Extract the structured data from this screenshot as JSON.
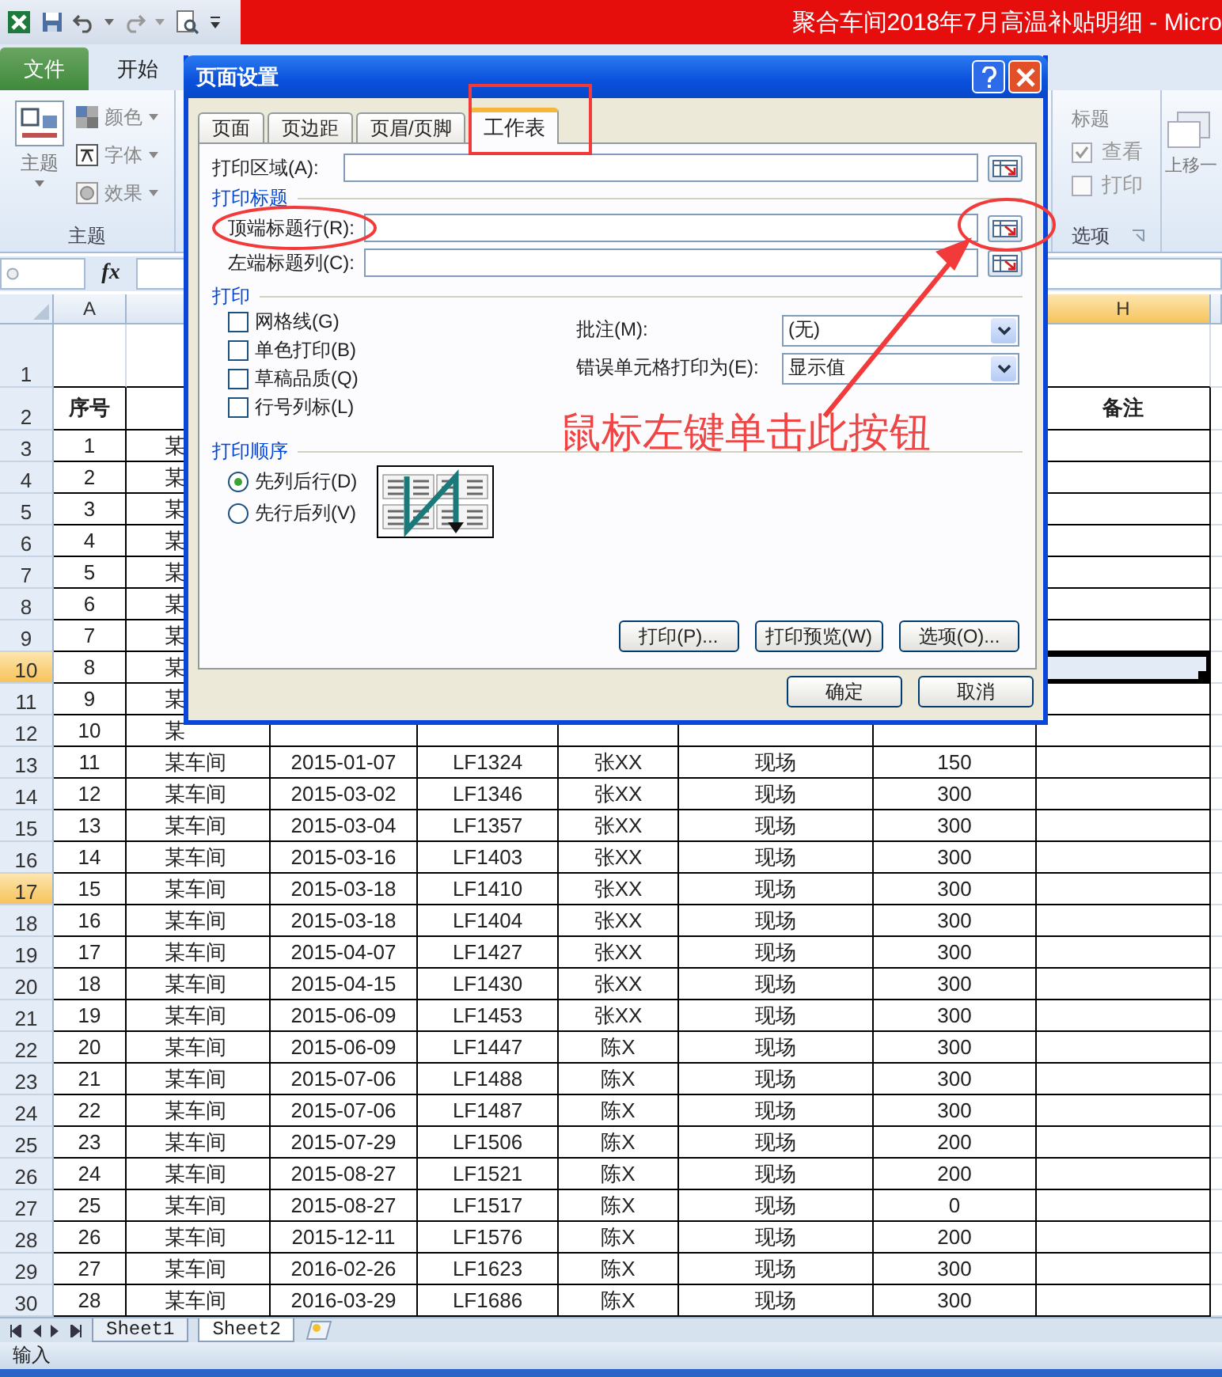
{
  "title_bar": {
    "title": "聚合车间2018年7月高温补贴明细 - Micro"
  },
  "ribbon_tabs": [
    {
      "label": "文件",
      "kind": "file"
    },
    {
      "label": "开始",
      "kind": "tab"
    }
  ],
  "ribbon": {
    "theme_group": {
      "big_button": "主题",
      "small_buttons": [
        "颜色",
        "字体",
        "效果"
      ],
      "label": "主题"
    },
    "sheet_options_group": {
      "heading": "标题",
      "checkboxes": [
        {
          "label": "查看",
          "checked": true
        },
        {
          "label": "打印",
          "checked": false
        }
      ],
      "label": "选项"
    },
    "arrange_button": "上移一"
  },
  "formula_bar": {
    "function_label": "fx"
  },
  "column_headers": [
    {
      "label": "A",
      "selected": false
    },
    {
      "label": "H",
      "selected": true
    }
  ],
  "rows": [
    {
      "number": "1",
      "selected": false,
      "note_cell_active": false
    },
    {
      "number": "2",
      "selected": false,
      "note_cell_active": false,
      "cells": [
        "序号",
        null,
        null,
        null,
        null,
        null,
        null,
        "备注"
      ]
    },
    {
      "number": "3",
      "selected": false,
      "note_cell_active": false,
      "cells": [
        "1",
        "某"
      ]
    },
    {
      "number": "4",
      "selected": false,
      "note_cell_active": false,
      "cells": [
        "2",
        "某"
      ]
    },
    {
      "number": "5",
      "selected": false,
      "note_cell_active": false,
      "cells": [
        "3",
        "某"
      ]
    },
    {
      "number": "6",
      "selected": false,
      "note_cell_active": false,
      "cells": [
        "4",
        "某"
      ]
    },
    {
      "number": "7",
      "selected": false,
      "note_cell_active": false,
      "cells": [
        "5",
        "某"
      ]
    },
    {
      "number": "8",
      "selected": false,
      "note_cell_active": false,
      "cells": [
        "6",
        "某"
      ]
    },
    {
      "number": "9",
      "selected": false,
      "note_cell_active": false,
      "cells": [
        "7",
        "某"
      ]
    },
    {
      "number": "10",
      "selected": true,
      "note_cell_active": true,
      "cells": [
        "8",
        "某"
      ]
    },
    {
      "number": "11",
      "selected": false,
      "note_cell_active": false,
      "cells": [
        "9",
        "某"
      ]
    },
    {
      "number": "12",
      "selected": false,
      "note_cell_active": false,
      "cells": [
        "10",
        "某"
      ]
    },
    {
      "number": "13",
      "selected": false,
      "note_cell_active": false,
      "cells": [
        "11",
        "某车间",
        "2015-01-07",
        "LF1324",
        "张XX",
        "现场",
        "150"
      ]
    },
    {
      "number": "14",
      "selected": false,
      "note_cell_active": false,
      "cells": [
        "12",
        "某车间",
        "2015-03-02",
        "LF1346",
        "张XX",
        "现场",
        "300"
      ]
    },
    {
      "number": "15",
      "selected": false,
      "note_cell_active": false,
      "cells": [
        "13",
        "某车间",
        "2015-03-04",
        "LF1357",
        "张XX",
        "现场",
        "300"
      ]
    },
    {
      "number": "16",
      "selected": false,
      "note_cell_active": false,
      "cells": [
        "14",
        "某车间",
        "2015-03-16",
        "LF1403",
        "张XX",
        "现场",
        "300"
      ]
    },
    {
      "number": "17",
      "selected": true,
      "note_cell_active": false,
      "cells": [
        "15",
        "某车间",
        "2015-03-18",
        "LF1410",
        "张XX",
        "现场",
        "300"
      ]
    },
    {
      "number": "18",
      "selected": false,
      "note_cell_active": false,
      "cells": [
        "16",
        "某车间",
        "2015-03-18",
        "LF1404",
        "张XX",
        "现场",
        "300"
      ]
    },
    {
      "number": "19",
      "selected": false,
      "note_cell_active": false,
      "cells": [
        "17",
        "某车间",
        "2015-04-07",
        "LF1427",
        "张XX",
        "现场",
        "300"
      ]
    },
    {
      "number": "20",
      "selected": false,
      "note_cell_active": false,
      "cells": [
        "18",
        "某车间",
        "2015-04-15",
        "LF1430",
        "张XX",
        "现场",
        "300"
      ]
    },
    {
      "number": "21",
      "selected": false,
      "note_cell_active": false,
      "cells": [
        "19",
        "某车间",
        "2015-06-09",
        "LF1453",
        "张XX",
        "现场",
        "300"
      ]
    },
    {
      "number": "22",
      "selected": false,
      "note_cell_active": false,
      "cells": [
        "20",
        "某车间",
        "2015-06-09",
        "LF1447",
        "陈X",
        "现场",
        "300"
      ]
    },
    {
      "number": "23",
      "selected": false,
      "note_cell_active": false,
      "cells": [
        "21",
        "某车间",
        "2015-07-06",
        "LF1488",
        "陈X",
        "现场",
        "300"
      ]
    },
    {
      "number": "24",
      "selected": false,
      "note_cell_active": false,
      "cells": [
        "22",
        "某车间",
        "2015-07-06",
        "LF1487",
        "陈X",
        "现场",
        "300"
      ]
    },
    {
      "number": "25",
      "selected": false,
      "note_cell_active": false,
      "cells": [
        "23",
        "某车间",
        "2015-07-29",
        "LF1506",
        "陈X",
        "现场",
        "200"
      ]
    },
    {
      "number": "26",
      "selected": false,
      "note_cell_active": false,
      "cells": [
        "24",
        "某车间",
        "2015-08-27",
        "LF1521",
        "陈X",
        "现场",
        "200"
      ]
    },
    {
      "number": "27",
      "selected": false,
      "note_cell_active": false,
      "cells": [
        "25",
        "某车间",
        "2015-08-27",
        "LF1517",
        "陈X",
        "现场",
        "0"
      ]
    },
    {
      "number": "28",
      "selected": false,
      "note_cell_active": false,
      "cells": [
        "26",
        "某车间",
        "2015-12-11",
        "LF1576",
        "陈X",
        "现场",
        "200"
      ]
    },
    {
      "number": "29",
      "selected": false,
      "note_cell_active": false,
      "cells": [
        "27",
        "某车间",
        "2016-02-26",
        "LF1623",
        "陈X",
        "现场",
        "300"
      ]
    },
    {
      "number": "30",
      "selected": false,
      "note_cell_active": false,
      "cells": [
        "28",
        "某车间",
        "2016-03-29",
        "LF1686",
        "陈X",
        "现场",
        "300"
      ]
    }
  ],
  "sheet_tabs": [
    {
      "label": "Sheet1",
      "selected": false
    },
    {
      "label": "Sheet2",
      "selected": true
    }
  ],
  "status_bar": {
    "mode": "输入"
  },
  "dialog": {
    "title": "页面设置",
    "tabs": [
      {
        "label": "页面",
        "selected": false
      },
      {
        "label": "页边距",
        "selected": false
      },
      {
        "label": "页眉/页脚",
        "selected": false
      },
      {
        "label": "工作表",
        "selected": true
      }
    ],
    "print_area_label": "打印区域(A):",
    "print_titles": {
      "heading": "打印标题",
      "rows_label": "顶端标题行(R):",
      "columns_label": "左端标题列(C):"
    },
    "print": {
      "heading": "打印",
      "checkboxes": [
        {
          "label": "网格线(G)",
          "checked": false
        },
        {
          "label": "单色打印(B)",
          "checked": false
        },
        {
          "label": "草稿品质(Q)",
          "checked": false
        },
        {
          "label": "行号列标(L)",
          "checked": false
        }
      ],
      "comments": {
        "label": "批注(M):",
        "value": "(无)"
      },
      "errors": {
        "label": "错误单元格打印为(E):",
        "value": "显示值"
      }
    },
    "page_order": {
      "heading": "打印顺序",
      "options": [
        {
          "label": "先列后行(D)",
          "selected": true
        },
        {
          "label": "先行后列(V)",
          "selected": false
        }
      ]
    },
    "buttons": [
      "打印(P)...",
      "打印预览(W)",
      "选项(O)..."
    ],
    "footer_buttons": [
      "确定",
      "取消"
    ]
  },
  "annotation": {
    "text": "鼠标左键单击此按钮"
  }
}
